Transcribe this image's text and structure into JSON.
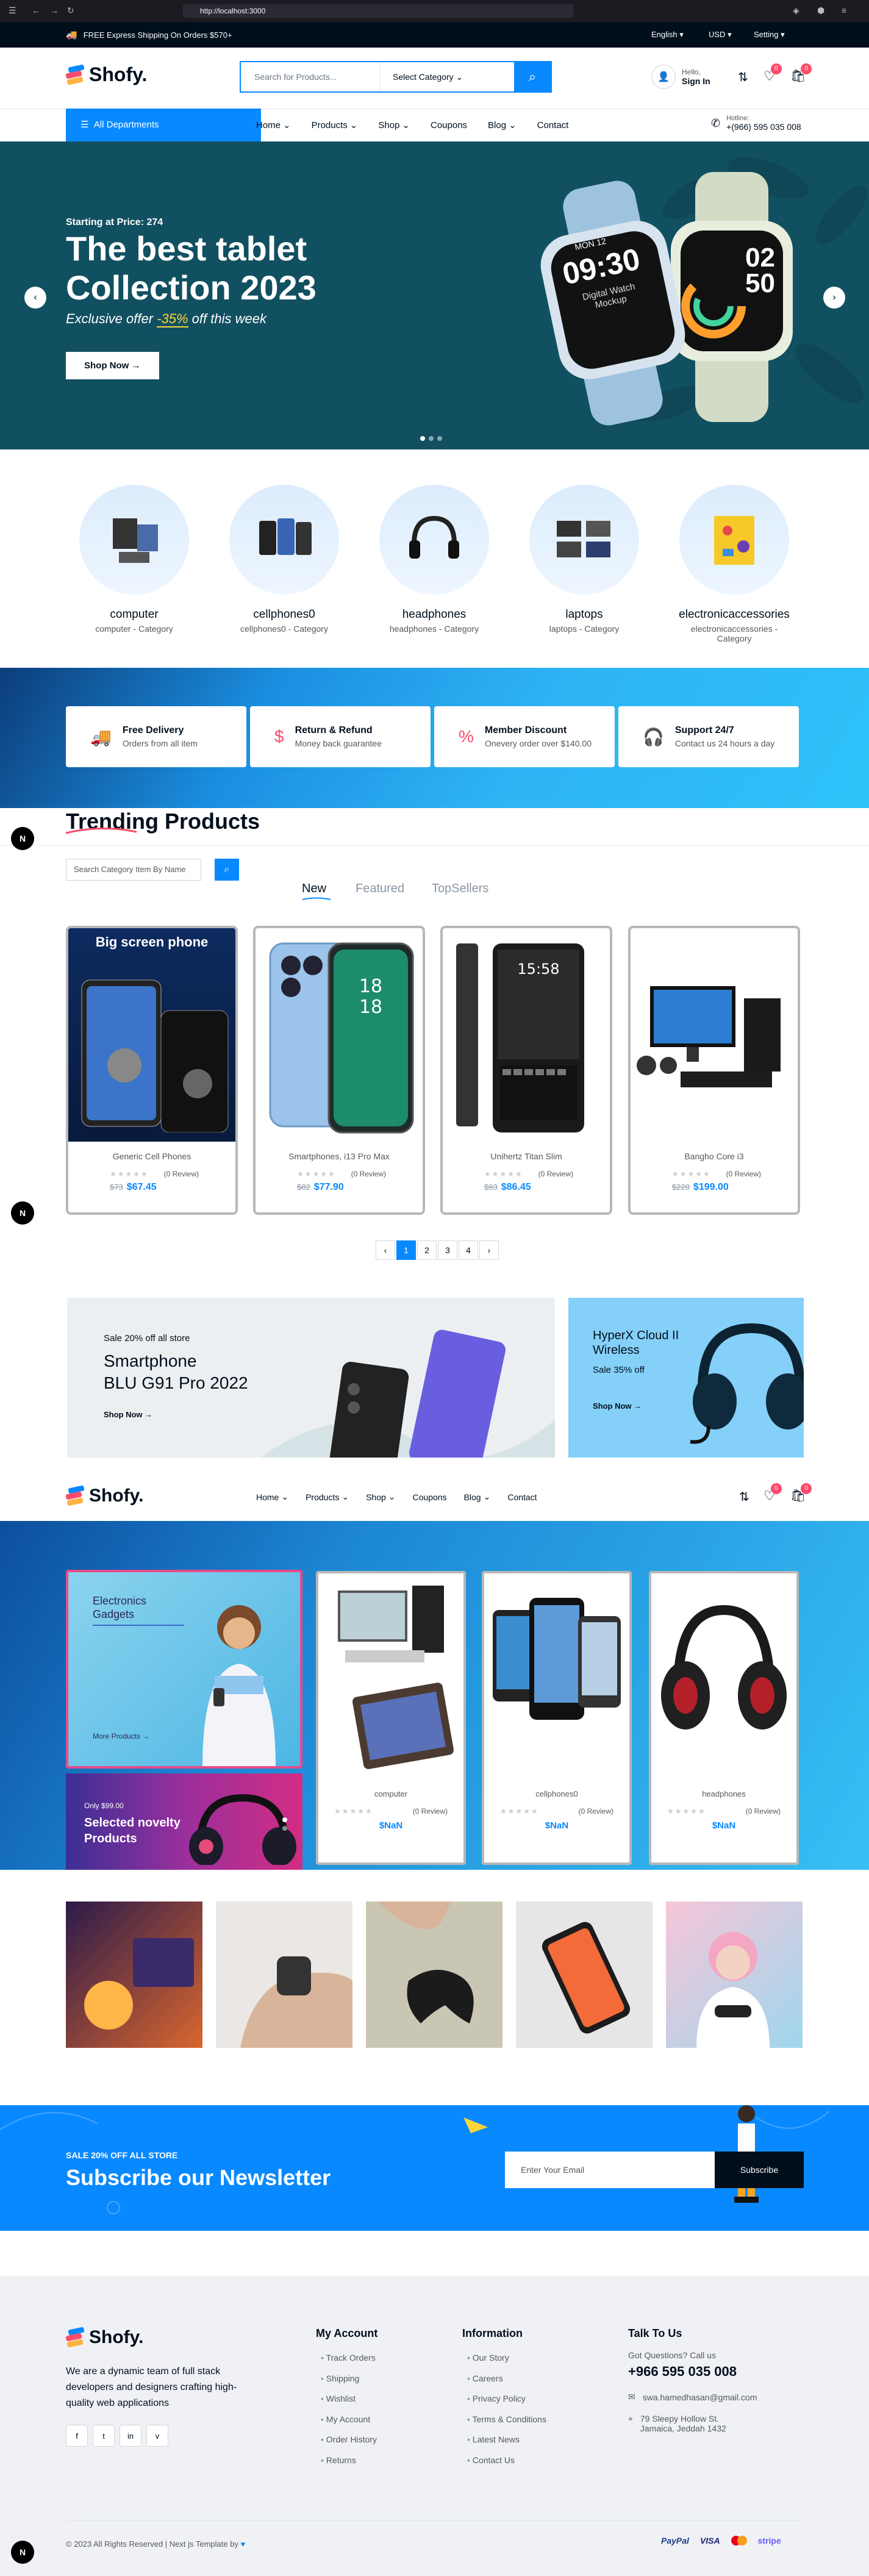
{
  "browser": {
    "url": "http://localhost:3000"
  },
  "topbar": {
    "shipping": "FREE Express Shipping On Orders $570+",
    "language": "English",
    "currency": "USD",
    "setting": "Setting"
  },
  "brand": {
    "name": "Shofy."
  },
  "search": {
    "placeholder": "Search for Products...",
    "category": "Select Category"
  },
  "account": {
    "hello": "Hello,",
    "signin": "Sign In",
    "wishlist_count": "0",
    "cart_count": "0"
  },
  "nav": {
    "all_departments": "All Departments",
    "items": [
      "Home",
      "Products",
      "Shop",
      "Coupons",
      "Blog",
      "Contact"
    ],
    "hotline_label": "Hotline:",
    "hotline": "+(966) 595 035 008"
  },
  "hero": {
    "pre": "Starting at Price: 274",
    "title_line1": "The best tablet",
    "title_line2": "Collection 2023",
    "offer_prefix": "Exclusive offer",
    "offer_pct": "-35%",
    "offer_suffix": "off this week",
    "button": "Shop Now",
    "watch1_time": "09:30",
    "watch1_date": "MON 12",
    "watch1_label": "Digital Watch Mockup",
    "watch2_time": "02 50"
  },
  "categories": [
    {
      "name": "computer",
      "sub": "computer - Category"
    },
    {
      "name": "cellphones0",
      "sub": "cellphones0 - Category"
    },
    {
      "name": "headphones",
      "sub": "headphones - Category"
    },
    {
      "name": "laptops",
      "sub": "laptops - Category"
    },
    {
      "name": "electronicaccessories",
      "sub": "electronicaccessories - Category"
    }
  ],
  "features": [
    {
      "title": "Free Delivery",
      "sub": "Orders from all item"
    },
    {
      "title": "Return & Refund",
      "sub": "Money back guarantee"
    },
    {
      "title": "Member Discount",
      "sub": "Onevery order over $140.00"
    },
    {
      "title": "Support 24/7",
      "sub": "Contact us 24 hours a day"
    }
  ],
  "trending": {
    "title": "Trending Products",
    "search_placeholder": "Search Category Item By Name",
    "tabs": [
      "New",
      "Featured",
      "TopSellers"
    ],
    "products": [
      {
        "name": "Generic Cell Phones",
        "reviews": "(0 Review)",
        "old": "$73",
        "price": "$67.45",
        "banner": "Big screen phone"
      },
      {
        "name": "Smartphones, i13 Pro Max",
        "reviews": "(0 Review)",
        "old": "$82",
        "price": "$77.90"
      },
      {
        "name": "Unihertz Titan Slim",
        "reviews": "(0 Review)",
        "old": "$93",
        "price": "$86.45"
      },
      {
        "name": "Bangho Core i3",
        "reviews": "(0 Review)",
        "old": "$220",
        "price": "$199.00"
      }
    ],
    "pages": [
      "1",
      "2",
      "3",
      "4"
    ]
  },
  "banner1": {
    "small": "Sale 20% off all store",
    "title1": "Smartphone",
    "title2": "BLU G91 Pro 2022",
    "button": "Shop Now"
  },
  "banner2": {
    "title1": "HyperX Cloud II",
    "title2": "Wireless",
    "sale": "Sale 35% off",
    "button": "Shop Now"
  },
  "gadgets": {
    "title1": "Electronics",
    "title2": "Gadgets",
    "more": "More Products",
    "novelty_price": "Only $99.00",
    "novelty_title1": "Selected novelty",
    "novelty_title2": "Products",
    "products": [
      {
        "name": "computer",
        "reviews": "(0 Review)",
        "price": "$NaN"
      },
      {
        "name": "cellphones0",
        "reviews": "(0 Review)",
        "price": "$NaN"
      },
      {
        "name": "headphones",
        "reviews": "(0 Review)",
        "price": "$NaN"
      }
    ]
  },
  "newsletter": {
    "small": "SALE 20% OFF ALL STORE",
    "title": "Subscribe our Newsletter",
    "placeholder": "Enter Your Email",
    "button": "Subscribe"
  },
  "footer": {
    "about": "We are a dynamic team of full stack developers and designers crafting high-quality web applications",
    "account_title": "My Account",
    "account_links": [
      "Track Orders",
      "Shipping",
      "Wishlist",
      "My Account",
      "Order History",
      "Returns"
    ],
    "info_title": "Information",
    "info_links": [
      "Our Story",
      "Careers",
      "Privacy Policy",
      "Terms & Conditions",
      "Latest News",
      "Contact Us"
    ],
    "talk_title": "Talk To Us",
    "question": "Got Questions? Call us",
    "phone": "+966 595 035 008",
    "email": "swa.hamedhasan@gmail.com",
    "address1": "79 Sleepy Hollow St.",
    "address2": "Jamaica, Jeddah 1432",
    "copyright": "© 2023 All Rights Reserved | Next js Template by",
    "payments": [
      "PayPal",
      "VISA",
      "stripe"
    ]
  }
}
